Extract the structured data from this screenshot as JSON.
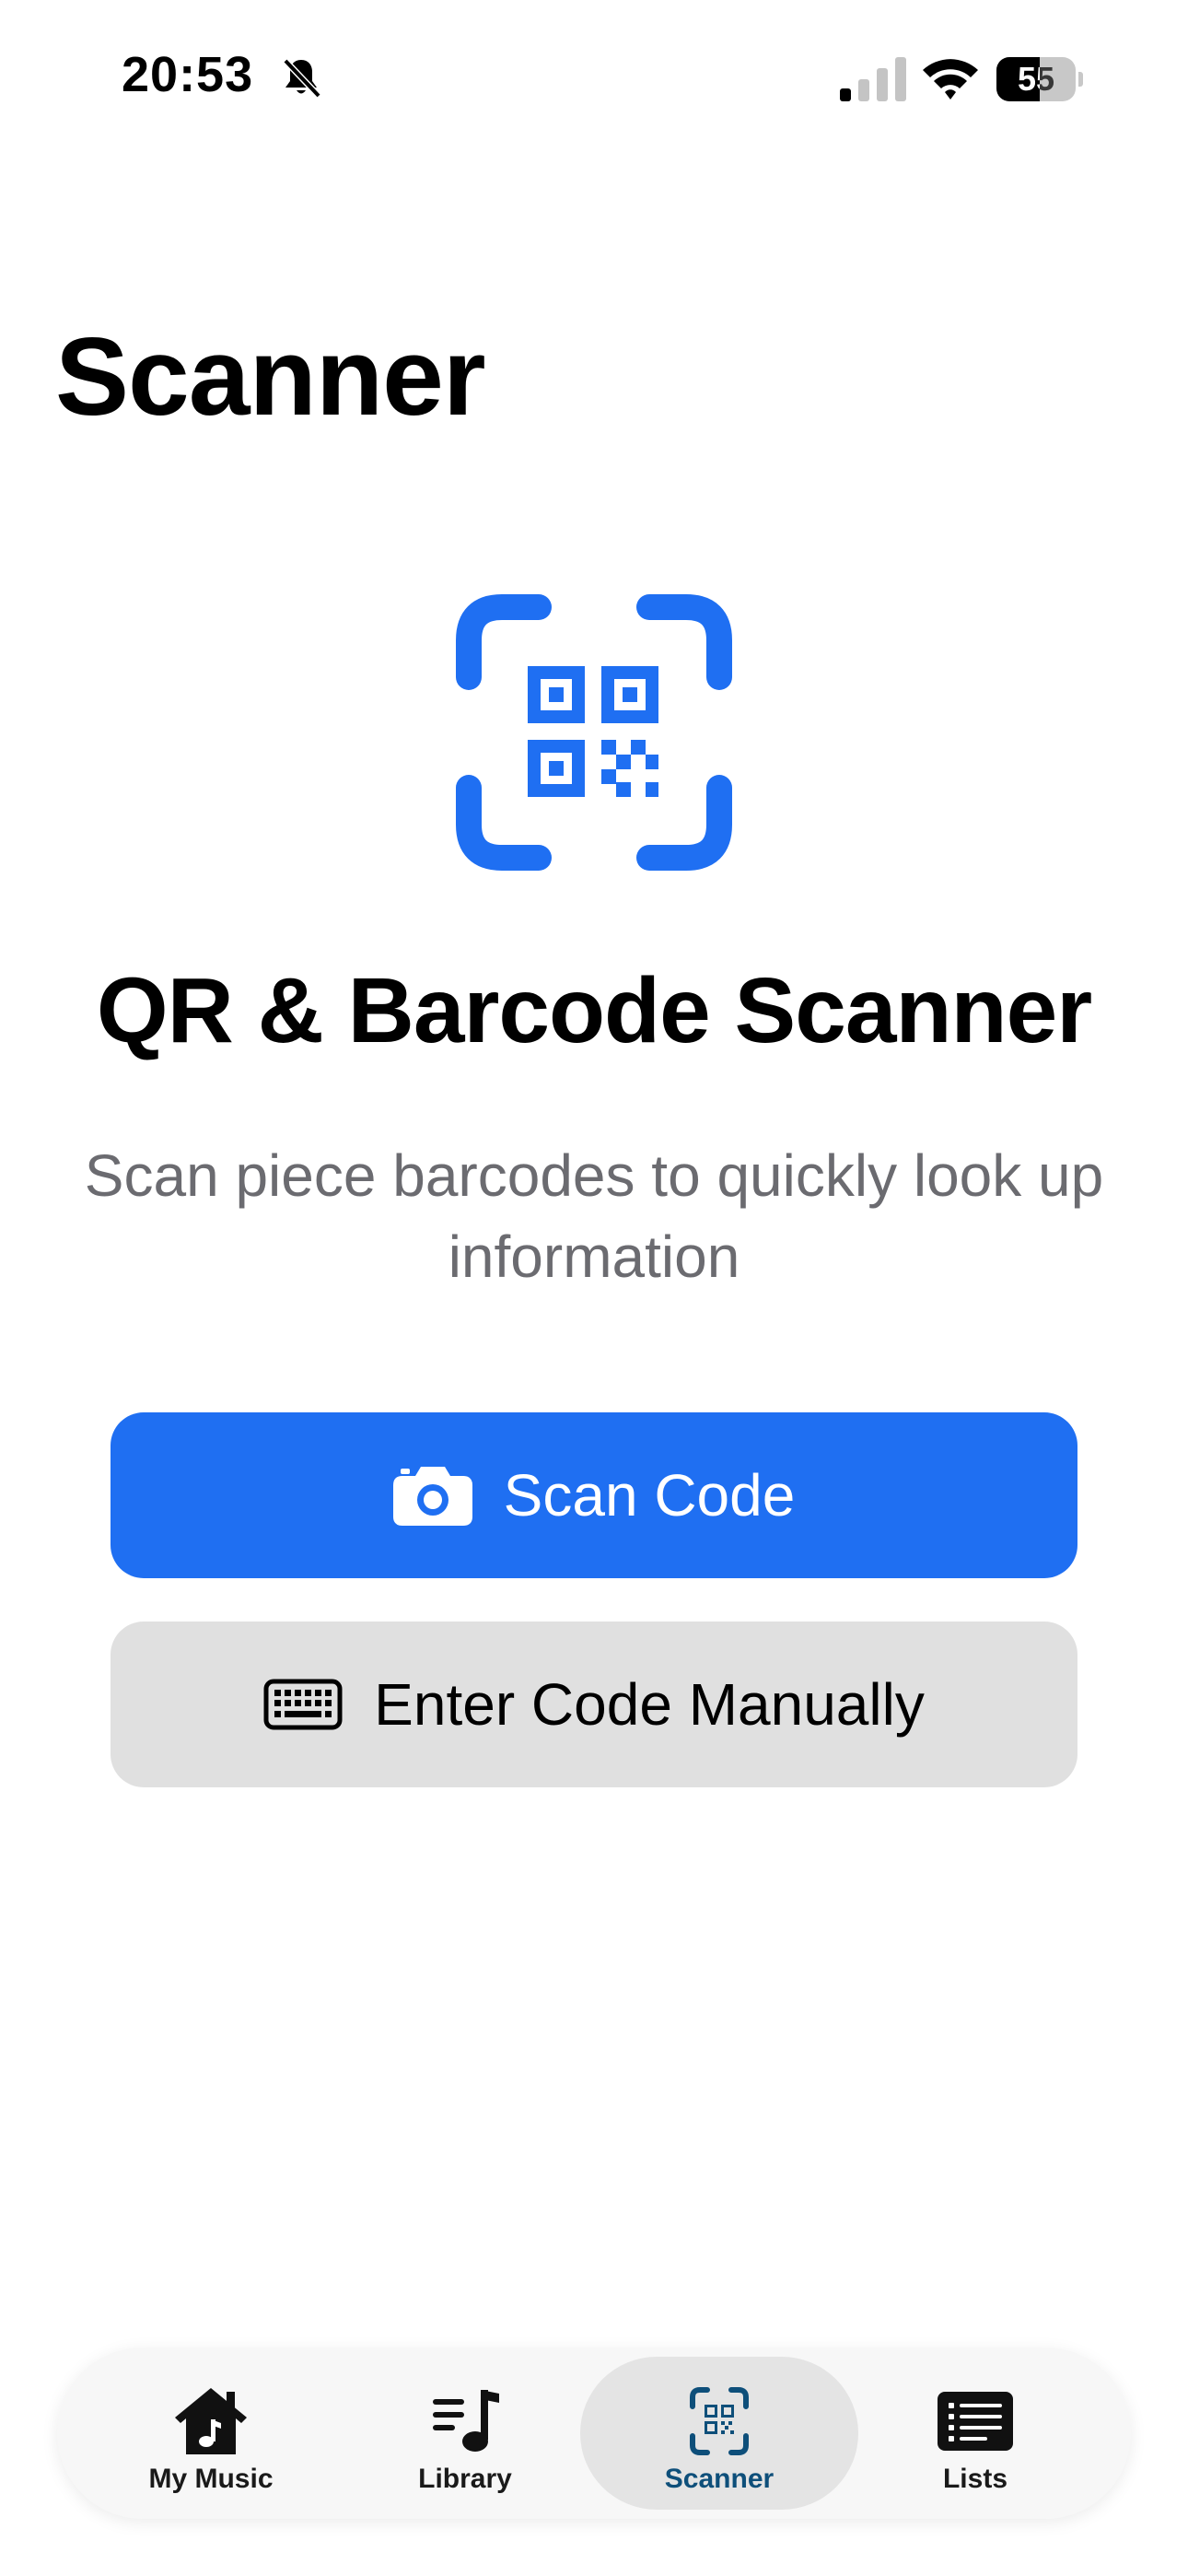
{
  "status": {
    "time": "20:53",
    "battery_level": "55",
    "battery_fraction": 0.55
  },
  "page": {
    "title": "Scanner"
  },
  "hero": {
    "icon": "qr-scanner-icon",
    "accent_color": "#1f6ff2",
    "heading": "QR & Barcode Scanner",
    "subtitle": "Scan piece barcodes to quickly look up information"
  },
  "actions": {
    "scan_label": "Scan Code",
    "scan_icon": "camera-icon",
    "manual_label": "Enter Code Manually",
    "manual_icon": "keyboard-icon"
  },
  "tabbar": {
    "active": "Scanner",
    "active_color": "#0e4f7a",
    "tabs": [
      {
        "label": "My Music",
        "icon": "house-music-icon"
      },
      {
        "label": "Library",
        "icon": "music-list-icon"
      },
      {
        "label": "Scanner",
        "icon": "qr-scanner-icon"
      },
      {
        "label": "Lists",
        "icon": "list-icon"
      }
    ]
  }
}
